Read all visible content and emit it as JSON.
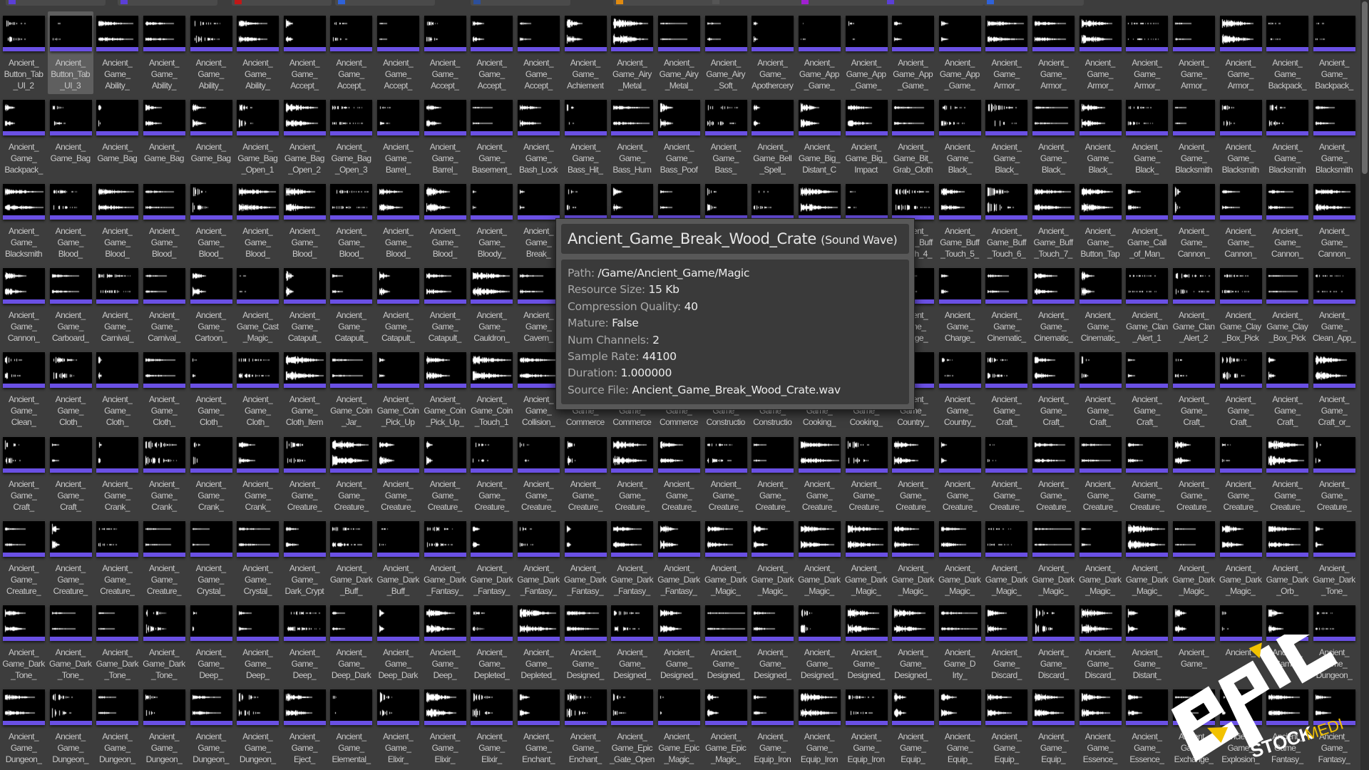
{
  "top_folders": [
    {
      "color": "#5b3fd6"
    },
    {
      "color": "#5b3fd6"
    },
    {
      "color": "#c01818"
    },
    {
      "color": "#2f62d8"
    },
    {
      "color": "#2c4f9a"
    },
    {
      "color": "#e08a10"
    },
    {
      "color": "#555555"
    },
    {
      "color": "#a020d0"
    },
    {
      "color": "#5b3fd6"
    },
    {
      "color": "#2f62d8"
    }
  ],
  "accent": "#6a50e4",
  "selected_asset": "Ancient_Button_Tab_UI_3",
  "assets": [
    [
      [
        "Ancient_",
        "Button_Tab",
        "_UI_2"
      ],
      [
        "Ancient_",
        "Button_Tab",
        "_UI_3"
      ],
      [
        "Ancient_",
        "Game_",
        "Ability_"
      ],
      [
        "Ancient_",
        "Game_",
        "Ability_"
      ],
      [
        "Ancient_",
        "Game_",
        "Ability_"
      ],
      [
        "Ancient_",
        "Game_",
        "Ability_"
      ],
      [
        "Ancient_",
        "Game_",
        "Accept_"
      ],
      [
        "Ancient_",
        "Game_",
        "Accept_"
      ],
      [
        "Ancient_",
        "Game_",
        "Accept_"
      ],
      [
        "Ancient_",
        "Game_",
        "Accept_"
      ],
      [
        "Ancient_",
        "Game_",
        "Accept_"
      ],
      [
        "Ancient_",
        "Game_",
        "Accept_"
      ],
      [
        "Ancient_",
        "Game_",
        "Achiement"
      ],
      [
        "Ancient_",
        "Game_Airy",
        "_Metal_"
      ],
      [
        "Ancient_",
        "Game_Airy",
        "_Metal_"
      ],
      [
        "Ancient_",
        "Game_Airy",
        "_Soft_"
      ],
      [
        "Ancient_",
        "Game_",
        "Apothercery"
      ],
      [
        "Ancient_",
        "Game_App",
        "_Game_"
      ],
      [
        "Ancient_",
        "Game_App",
        "_Game_"
      ],
      [
        "Ancient_",
        "Game_App",
        "_Game_"
      ],
      [
        "Ancient_",
        "Game_App",
        "_Game_"
      ],
      [
        "Ancient_",
        "Game_",
        "Armor_"
      ],
      [
        "Ancient_",
        "Game_",
        "Armor_"
      ],
      [
        "Ancient_",
        "Game_",
        "Armor_"
      ],
      [
        "Ancient_",
        "Game_",
        "Armor_"
      ],
      [
        "Ancient_",
        "Game_",
        "Armor_"
      ],
      [
        "Ancient_",
        "Game_",
        "Armor_"
      ],
      [
        "Ancient_",
        "Game_",
        "Backpack_"
      ],
      [
        "Ancient_",
        "Game_",
        "Backpack_"
      ]
    ],
    [
      [
        "Ancient_",
        "Game_",
        "Backpack_"
      ],
      [
        "Ancient_",
        "Game_Bag"
      ],
      [
        "Ancient_",
        "Game_Bag"
      ],
      [
        "Ancient_",
        "Game_Bag"
      ],
      [
        "Ancient_",
        "Game_Bag"
      ],
      [
        "Ancient_",
        "Game_Bag",
        "_Open_1"
      ],
      [
        "Ancient_",
        "Game_Bag",
        "_Open_2"
      ],
      [
        "Ancient_",
        "Game_Bag",
        "_Open_3"
      ],
      [
        "Ancient_",
        "Game_",
        "Barrel_"
      ],
      [
        "Ancient_",
        "Game_",
        "Barrel_"
      ],
      [
        "Ancient_",
        "Game_",
        "Basement_"
      ],
      [
        "Ancient_",
        "Game_",
        "Bash_Lock"
      ],
      [
        "Ancient_",
        "Game_",
        "Bass_Hit_"
      ],
      [
        "Ancient_",
        "Game_",
        "Bass_Hum"
      ],
      [
        "Ancient_",
        "Game_",
        "Bass_Poof"
      ],
      [
        "Ancient_",
        "Game_",
        "Bass_"
      ],
      [
        "Ancient_",
        "Game_Bell",
        "_Spell_"
      ],
      [
        "Ancient_",
        "Game_Big_",
        "Distant_C"
      ],
      [
        "Ancient_",
        "Game_Big_",
        "Impact"
      ],
      [
        "Ancient_",
        "Game_Bit_",
        "Grab_Cloth"
      ],
      [
        "Ancient_",
        "Game_",
        "Black_"
      ],
      [
        "Ancient_",
        "Game_",
        "Black_"
      ],
      [
        "Ancient_",
        "Game_",
        "Black_"
      ],
      [
        "Ancient_",
        "Game_",
        "Black_"
      ],
      [
        "Ancient_",
        "Game_",
        "Black_"
      ],
      [
        "Ancient_",
        "Game_",
        "Blacksmith"
      ],
      [
        "Ancient_",
        "Game_",
        "Blacksmith"
      ],
      [
        "Ancient_",
        "Game_",
        "Blacksmith"
      ],
      [
        "Ancient_",
        "Game_",
        "Blacksmith"
      ]
    ],
    [
      [
        "Ancient_",
        "Game_",
        "Blacksmith"
      ],
      [
        "Ancient_",
        "Game_",
        "Blood_"
      ],
      [
        "Ancient_",
        "Game_",
        "Blood_"
      ],
      [
        "Ancient_",
        "Game_",
        "Blood_"
      ],
      [
        "Ancient_",
        "Game_",
        "Blood_"
      ],
      [
        "Ancient_",
        "Game_",
        "Blood_"
      ],
      [
        "Ancient_",
        "Game_",
        "Blood_"
      ],
      [
        "Ancient_",
        "Game_",
        "Blood_"
      ],
      [
        "Ancient_",
        "Game_",
        "Blood_"
      ],
      [
        "Ancient_",
        "Game_",
        "Blood_"
      ],
      [
        "Ancient_",
        "Game_",
        "Bloody_"
      ],
      [
        "Ancient_",
        "Game_",
        "Break_"
      ],
      [],
      [],
      [],
      [],
      [],
      [],
      [],
      [
        "Ancient_",
        "Game_Buff",
        "_Touch_4_"
      ],
      [
        "Ancient_",
        "Game_Buff",
        "_Touch_5_"
      ],
      [
        "Ancient_",
        "Game_Buff",
        "_Touch_6_"
      ],
      [
        "Ancient_",
        "Game_Buff",
        "_Touch_7_"
      ],
      [
        "Ancient_",
        "Game_",
        "Button_Tap"
      ],
      [
        "Ancient_",
        "Game_Call",
        "_of_Man_"
      ],
      [
        "Ancient_",
        "Game_",
        "Cannon_"
      ],
      [
        "Ancient_",
        "Game_",
        "Cannon_"
      ],
      [
        "Ancient_",
        "Game_",
        "Cannon_"
      ],
      [
        "Ancient_",
        "Game_",
        "Cannon_"
      ]
    ],
    [
      [
        "Ancient_",
        "Game_",
        "Cannon_"
      ],
      [
        "Ancient_",
        "Game_",
        "Carboard_"
      ],
      [
        "Ancient_",
        "Game_",
        "Carnival_"
      ],
      [
        "Ancient_",
        "Game_",
        "Carnival_"
      ],
      [
        "Ancient_",
        "Game_",
        "Cartoon_"
      ],
      [
        "Ancient_",
        "Game_Cast",
        "_Magic_"
      ],
      [
        "Ancient_",
        "Game_",
        "Catapult_"
      ],
      [
        "Ancient_",
        "Game_",
        "Catapult_"
      ],
      [
        "Ancient_",
        "Game_",
        "Catapult_"
      ],
      [
        "Ancient_",
        "Game_",
        "Catapult_"
      ],
      [
        "Ancient_",
        "Game_",
        "Cauldron_"
      ],
      [
        "Ancient_",
        "Game_",
        "Cavern_"
      ],
      [],
      [],
      [],
      [],
      [],
      [],
      [],
      [
        "Ancient_",
        "Game_",
        "Charge_"
      ],
      [
        "Ancient_",
        "Game_",
        "Charge_"
      ],
      [
        "Ancient_",
        "Game_",
        "Cinematic_"
      ],
      [
        "Ancient_",
        "Game_",
        "Cinematic_"
      ],
      [
        "Ancient_",
        "Game_",
        "Cinematic_"
      ],
      [
        "Ancient_",
        "Game_Clan",
        "_Alert_1"
      ],
      [
        "Ancient_",
        "Game_Clan",
        "_Alert_2"
      ],
      [
        "Ancient_",
        "Game_Clay",
        "_Box_Pick"
      ],
      [
        "Ancient_",
        "Game_Clay",
        "_Box_Pick"
      ],
      [
        "Ancient_",
        "Game_",
        "Clean_App_"
      ]
    ],
    [
      [
        "Ancient_",
        "Game_",
        "Clean_"
      ],
      [
        "Ancient_",
        "Game_",
        "Cloth_"
      ],
      [
        "Ancient_",
        "Game_",
        "Cloth_"
      ],
      [
        "Ancient_",
        "Game_",
        "Cloth_"
      ],
      [
        "Ancient_",
        "Game_",
        "Cloth_"
      ],
      [
        "Ancient_",
        "Game_",
        "Cloth_"
      ],
      [
        "Ancient_",
        "Game_",
        "Cloth_Item"
      ],
      [
        "Ancient_",
        "Game_Coin",
        "_Jar_"
      ],
      [
        "Ancient_",
        "Game_Coin",
        "_Pick_Up"
      ],
      [
        "Ancient_",
        "Game_Coin",
        "_Pick_Up_"
      ],
      [
        "Ancient_",
        "Game_Coin",
        "_Touch_1"
      ],
      [
        "Ancient_",
        "Game_",
        "Collision_"
      ],
      [
        "Ancient_",
        "Game_",
        "Commerce"
      ],
      [
        "Ancient_",
        "Game_",
        "Commerce"
      ],
      [
        "Ancient_",
        "Game_",
        "Commerce"
      ],
      [
        "Ancient_",
        "Game_",
        "Constructio"
      ],
      [
        "Ancient_",
        "Game_",
        "Constructio"
      ],
      [
        "Ancient_",
        "Game_",
        "Cooking_"
      ],
      [
        "Ancient_",
        "Game_",
        "Cooking_"
      ],
      [
        "Ancient_",
        "Game_",
        "Country_"
      ],
      [
        "Ancient_",
        "Game_",
        "Country_"
      ],
      [
        "Ancient_",
        "Game_",
        "Craft_"
      ],
      [
        "Ancient_",
        "Game_",
        "Craft_"
      ],
      [
        "Ancient_",
        "Game_",
        "Craft_"
      ],
      [
        "Ancient_",
        "Game_",
        "Craft_"
      ],
      [
        "Ancient_",
        "Game_",
        "Craft_"
      ],
      [
        "Ancient_",
        "Game_",
        "Craft_"
      ],
      [
        "Ancient_",
        "Game_",
        "Craft_"
      ],
      [
        "Ancient_",
        "Game_",
        "Craft_or_"
      ]
    ],
    [
      [
        "Ancient_",
        "Game_",
        "Craft_"
      ],
      [
        "Ancient_",
        "Game_",
        "Craft_"
      ],
      [
        "Ancient_",
        "Game_",
        "Crank_"
      ],
      [
        "Ancient_",
        "Game_",
        "Crank_"
      ],
      [
        "Ancient_",
        "Game_",
        "Crank_"
      ],
      [
        "Ancient_",
        "Game_",
        "Crank_"
      ],
      [
        "Ancient_",
        "Game_",
        "Creature_"
      ],
      [
        "Ancient_",
        "Game_",
        "Creature_"
      ],
      [
        "Ancient_",
        "Game_",
        "Creature_"
      ],
      [
        "Ancient_",
        "Game_",
        "Creature_"
      ],
      [
        "Ancient_",
        "Game_",
        "Creature_"
      ],
      [
        "Ancient_",
        "Game_",
        "Creature_"
      ],
      [
        "Ancient_",
        "Game_",
        "Creature_"
      ],
      [
        "Ancient_",
        "Game_",
        "Creature_"
      ],
      [
        "Ancient_",
        "Game_",
        "Creature_"
      ],
      [
        "Ancient_",
        "Game_",
        "Creature_"
      ],
      [
        "Ancient_",
        "Game_",
        "Creature_"
      ],
      [
        "Ancient_",
        "Game_",
        "Creature_"
      ],
      [
        "Ancient_",
        "Game_",
        "Creature_"
      ],
      [
        "Ancient_",
        "Game_",
        "Creature_"
      ],
      [
        "Ancient_",
        "Game_",
        "Creature_"
      ],
      [
        "Ancient_",
        "Game_",
        "Creature_"
      ],
      [
        "Ancient_",
        "Game_",
        "Creature_"
      ],
      [
        "Ancient_",
        "Game_",
        "Creature_"
      ],
      [
        "Ancient_",
        "Game_",
        "Creature_"
      ],
      [
        "Ancient_",
        "Game_",
        "Creature_"
      ],
      [
        "Ancient_",
        "Game_",
        "Creature_"
      ],
      [
        "Ancient_",
        "Game_",
        "Creature_"
      ],
      [
        "Ancient_",
        "Game_",
        "Creature_"
      ]
    ],
    [
      [
        "Ancient_",
        "Game_",
        "Creature_"
      ],
      [
        "Ancient_",
        "Game_",
        "Creature_"
      ],
      [
        "Ancient_",
        "Game_",
        "Creature_"
      ],
      [
        "Ancient_",
        "Game_",
        "Creature_"
      ],
      [
        "Ancient_",
        "Game_",
        "Crystal_"
      ],
      [
        "Ancient_",
        "Game_",
        "Crystal_"
      ],
      [
        "Ancient_",
        "Game_",
        "Dark_Crypt"
      ],
      [
        "Ancient_",
        "Game_Dark",
        "_Buff_"
      ],
      [
        "Ancient_",
        "Game_Dark",
        "_Buff_"
      ],
      [
        "Ancient_",
        "Game_Dark",
        "_Fantasy_"
      ],
      [
        "Ancient_",
        "Game_Dark",
        "_Fantasy_"
      ],
      [
        "Ancient_",
        "Game_Dark",
        "_Fantasy_"
      ],
      [
        "Ancient_",
        "Game_Dark",
        "_Fantasy_"
      ],
      [
        "Ancient_",
        "Game_Dark",
        "_Fantasy_"
      ],
      [
        "Ancient_",
        "Game_Dark",
        "_Fantasy_"
      ],
      [
        "Ancient_",
        "Game_Dark",
        "_Magic_"
      ],
      [
        "Ancient_",
        "Game_Dark",
        "_Magic_"
      ],
      [
        "Ancient_",
        "Game_Dark",
        "_Magic_"
      ],
      [
        "Ancient_",
        "Game_Dark",
        "_Magic_"
      ],
      [
        "Ancient_",
        "Game_Dark",
        "_Magic_"
      ],
      [
        "Ancient_",
        "Game_Dark",
        "_Magic_"
      ],
      [
        "Ancient_",
        "Game_Dark",
        "_Magic_"
      ],
      [
        "Ancient_",
        "Game_Dark",
        "_Magic_"
      ],
      [
        "Ancient_",
        "Game_Dark",
        "_Magic_"
      ],
      [
        "Ancient_",
        "Game_Dark",
        "_Magic_"
      ],
      [
        "Ancient_",
        "Game_Dark",
        "_Magic_"
      ],
      [
        "Ancient_",
        "Game_Dark",
        "_Magic_"
      ],
      [
        "Ancient_",
        "Game_Dark",
        "_Orb_"
      ],
      [
        "Ancient_",
        "Game_Dark",
        "_Tone_"
      ]
    ],
    [
      [
        "Ancient_",
        "Game_Dark",
        "_Tone_"
      ],
      [
        "Ancient_",
        "Game_Dark",
        "_Tone_"
      ],
      [
        "Ancient_",
        "Game_Dark",
        "_Tone_"
      ],
      [
        "Ancient_",
        "Game_Dark",
        "_Tone_"
      ],
      [
        "Ancient_",
        "Game_",
        "Deep_"
      ],
      [
        "Ancient_",
        "Game_",
        "Deep_"
      ],
      [
        "Ancient_",
        "Game_",
        "Deep_"
      ],
      [
        "Ancient_",
        "Game_",
        "Deep_Dark"
      ],
      [
        "Ancient_",
        "Game_",
        "Deep_Dark"
      ],
      [
        "Ancient_",
        "Game_",
        "Deep_"
      ],
      [
        "Ancient_",
        "Game_",
        "Depleted_"
      ],
      [
        "Ancient_",
        "Game_",
        "Depleted_"
      ],
      [
        "Ancient_",
        "Game_",
        "Designed_"
      ],
      [
        "Ancient_",
        "Game_",
        "Designed_"
      ],
      [
        "Ancient_",
        "Game_",
        "Designed_"
      ],
      [
        "Ancient_",
        "Game_",
        "Designed_"
      ],
      [
        "Ancient_",
        "Game_",
        "Designed_"
      ],
      [
        "Ancient_",
        "Game_",
        "Designed_"
      ],
      [
        "Ancient_",
        "Game_",
        "Designed_"
      ],
      [
        "Ancient_",
        "Game_",
        "Designed_"
      ],
      [
        "Ancient_",
        "Game_D",
        "Irty_"
      ],
      [
        "Ancient_",
        "Game_",
        "Discard_"
      ],
      [
        "Ancient_",
        "Game_",
        "Discard_"
      ],
      [
        "Ancient_",
        "Game_",
        "Discard_"
      ],
      [
        "Ancient_",
        "Game_",
        "Distant_"
      ],
      [
        "Ancient_",
        "Game_"
      ],
      [
        "Ancient_"
      ],
      [
        "Ancient_",
        "Game_"
      ],
      [
        "Ancient_",
        "Game_",
        "Dungeon_"
      ]
    ],
    [
      [
        "Ancient_",
        "Game_",
        "Dungeon_"
      ],
      [
        "Ancient_",
        "Game_",
        "Dungeon_"
      ],
      [
        "Ancient_",
        "Game_",
        "Dungeon_"
      ],
      [
        "Ancient_",
        "Game_",
        "Dungeon_"
      ],
      [
        "Ancient_",
        "Game_",
        "Dungeon_"
      ],
      [
        "Ancient_",
        "Game_",
        "Dungeon_"
      ],
      [
        "Ancient_",
        "Game_",
        "Eject_"
      ],
      [
        "Ancient_",
        "Game_",
        "Elemental_"
      ],
      [
        "Ancient_",
        "Game_",
        "Elixir_"
      ],
      [
        "Ancient_",
        "Game_",
        "Elixir_"
      ],
      [
        "Ancient_",
        "Game_",
        "Elixir_"
      ],
      [
        "Ancient_",
        "Game_",
        "Enchant_"
      ],
      [
        "Ancient_",
        "Game_",
        "Enchant_"
      ],
      [
        "Ancient_",
        "Game_Epic",
        "_Gate_Open"
      ],
      [
        "Ancient_",
        "Game_Epic",
        "_Magic_"
      ],
      [
        "Ancient_",
        "Game_Epic",
        "_Magic_"
      ],
      [
        "Ancient_",
        "Game_",
        "Equip_Iron"
      ],
      [
        "Ancient_",
        "Game_",
        "Equip_Iron"
      ],
      [
        "Ancient_",
        "Game_",
        "Equip_Iron"
      ],
      [
        "Ancient_",
        "Game_",
        "Equip_"
      ],
      [
        "Ancient_",
        "Game_",
        "Equip_"
      ],
      [
        "Ancient_",
        "Game_",
        "Equip_"
      ],
      [
        "Ancient_",
        "Game_",
        "Equip_"
      ],
      [
        "Ancient_",
        "Game_",
        "Essence_"
      ],
      [
        "Ancient_",
        "Game_",
        "Essence_"
      ],
      [
        "Ancient_",
        "Game_",
        "Exchange_"
      ],
      [
        "Ancient_",
        "Game_",
        "Explosion_"
      ],
      [
        "Ancient_",
        "Game_",
        "Fantasy_"
      ],
      [
        "Ancient_",
        "Game_",
        "Fantasy_"
      ]
    ]
  ],
  "tooltip": {
    "title": "Ancient_Game_Break_Wood_Crate",
    "type": "(Sound Wave)",
    "rows": [
      {
        "key": "Path:",
        "value": "/Game/Ancient_Game/Magic"
      },
      {
        "key": "Resource Size:",
        "value": "15 Kb"
      },
      {
        "key": "Compression Quality:",
        "value": "40"
      },
      {
        "key": "Mature:",
        "value": "False"
      },
      {
        "key": "Num Channels:",
        "value": "2"
      },
      {
        "key": "Sample Rate:",
        "value": "44100"
      },
      {
        "key": "Duration:",
        "value": "1.000000"
      },
      {
        "key": "Source File:",
        "value": "Ancient_Game_Break_Wood_Crate.wav"
      }
    ]
  },
  "watermark": {
    "word": "epic",
    "sub1": "STOCK",
    "sub2": "MEDIA",
    "white": "#ffffff",
    "yellow": "#f2c200"
  }
}
